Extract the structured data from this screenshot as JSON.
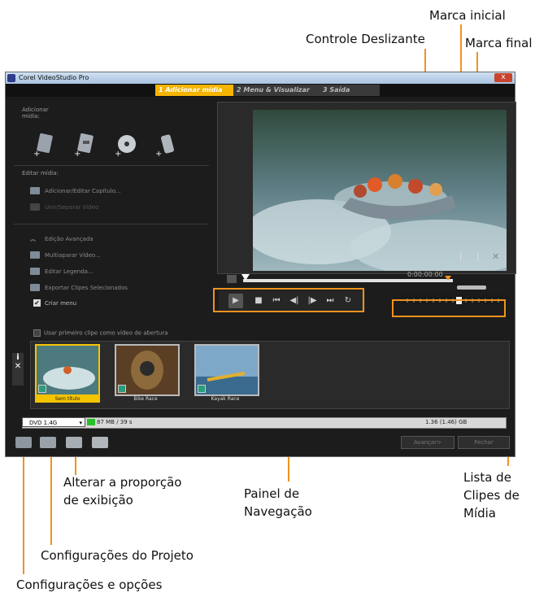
{
  "callouts": {
    "marca_inicial": "Marca inicial",
    "controle_deslizante": "Controle Deslizante",
    "marca_final": "Marca final",
    "alterar_proporcao_1": "Alterar a proporção",
    "alterar_proporcao_2": "de exibição",
    "painel_1": "Painel de",
    "painel_2": "Navegação",
    "lista_1": "Lista de",
    "lista_2": "Clipes de",
    "lista_3": "Mídia",
    "config_projeto": "Configurações do Projeto",
    "config_opcoes": "Configurações e opções"
  },
  "window": {
    "title": "Corel VideoStudio Pro",
    "close_label": "x"
  },
  "tabs": [
    {
      "label": "1 Adicionar mídia"
    },
    {
      "label": "2 Menu & Visualizar"
    },
    {
      "label": "3 Saída"
    }
  ],
  "left_panel": {
    "adicionar_1": "Adicionar",
    "adicionar_2": "mídia:",
    "editar_midia": "Editar mídia:",
    "items": [
      {
        "label": "Adicionar/Editar Capítulo..."
      },
      {
        "label": "Unir/Separar Vídeo"
      },
      {
        "label": "Edição Avançada"
      },
      {
        "label": "Multiaparar Vídeo..."
      },
      {
        "label": "Editar Legenda..."
      },
      {
        "label": "Exportar Clipes Selecionados"
      },
      {
        "label": "Criar menu"
      }
    ],
    "usar_primeiro": "Usar primeiro clipe como vídeo de abertura"
  },
  "player": {
    "timecode": "0:00:00:00",
    "bracket_start": "[",
    "bracket_end": "]",
    "remove": "✕"
  },
  "clips": [
    {
      "label": "Sem título"
    },
    {
      "label": "Bike Race"
    },
    {
      "label": "Kayak Race"
    }
  ],
  "clip_strip_side": {
    "info": "i",
    "close": "✕"
  },
  "storage": {
    "disc": "DVD 1.4G",
    "used": "87 MB / 39 s",
    "capacity": "1.36 (1.46) GB"
  },
  "buttons": {
    "avancar": "Avançar>",
    "fechar": "Fechar"
  },
  "colors": {
    "callout_line": "#f0931e",
    "active_tab": "#f5b400"
  }
}
